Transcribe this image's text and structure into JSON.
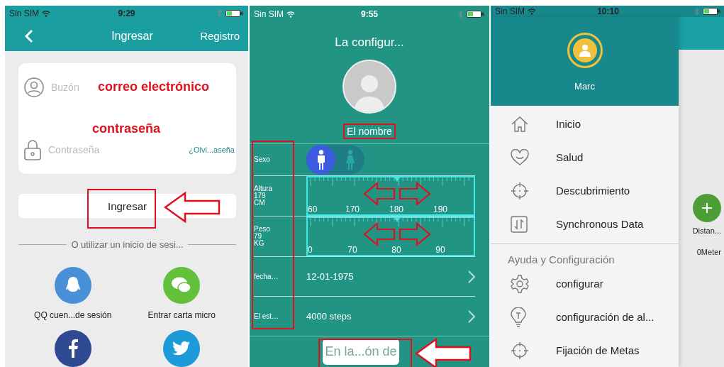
{
  "login_screen": {
    "status_bar": {
      "carrier": "Sin SIM",
      "time": "9:29"
    },
    "nav": {
      "title": "Ingresar",
      "action": "Registro"
    },
    "fields": [
      {
        "kind": "user",
        "placeholder": "Buzón",
        "note": "correo electrónico"
      },
      {
        "kind": "lock",
        "placeholder": "Contraseña",
        "note": "contraseña",
        "link": "¿Olvi...aseña"
      }
    ],
    "button": "Ingresar",
    "divider": "O utilizar un inicio de sesi...",
    "social": [
      {
        "kind": "qq",
        "label": "QQ cuen...de sesión"
      },
      {
        "kind": "wechat",
        "label": "Entrar carta micro"
      },
      {
        "kind": "facebook"
      },
      {
        "kind": "twitter"
      }
    ]
  },
  "profile_screen": {
    "status_bar": {
      "carrier": "Sin SIM",
      "time": "9:55"
    },
    "title": "La configur...",
    "name": "El nombre",
    "sex": {
      "label": "Sexo",
      "options": [
        {
          "kind": "male",
          "selected": true
        },
        {
          "kind": "female",
          "selected": false
        }
      ]
    },
    "rulers": [
      {
        "label": "Altura",
        "value": "179",
        "unit": "CM",
        "level": 0.54,
        "ticks": [
          "60",
          "170",
          "180",
          "190"
        ]
      },
      {
        "label": "Peso",
        "value": "79",
        "unit": "KG",
        "level": 0.54,
        "ticks": [
          "0",
          "70",
          "80",
          "90"
        ]
      }
    ],
    "rows": [
      {
        "label": "fecha…",
        "value": "12-01-1975"
      },
      {
        "label": "El est…",
        "value": "4000 steps"
      }
    ],
    "button": "En la...ón de"
  },
  "menu_screen": {
    "status_bar": {
      "carrier": "Sin SIM",
      "time": "10:10"
    },
    "user": "Marc",
    "items": [
      {
        "kind": "home",
        "label": "Inicio"
      },
      {
        "kind": "heart",
        "label": "Salud"
      },
      {
        "kind": "target",
        "label": "Descubrimiento"
      },
      {
        "kind": "sync",
        "label": "Synchronous Data"
      }
    ],
    "section": "Ayuda y Configuración",
    "section_items": [
      {
        "kind": "gear",
        "label": "configurar"
      },
      {
        "kind": "bulb",
        "label": "configuración de al..."
      },
      {
        "kind": "target",
        "label": "Fijación de Metas"
      }
    ],
    "background": {
      "label": "Distan...",
      "reading": "0Meter"
    }
  }
}
